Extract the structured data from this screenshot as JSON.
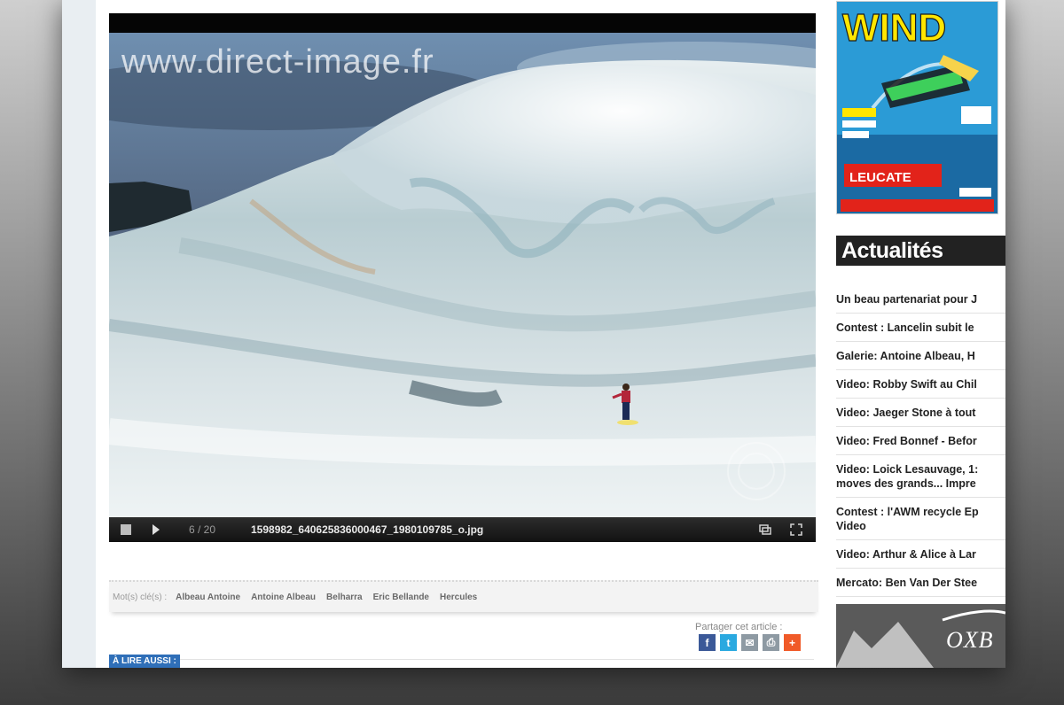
{
  "viewer": {
    "watermark": "www.direct-image.fr",
    "counter": "6 / 20",
    "filename": "1598982_640625836000467_1980109785_o.jpg",
    "icons": [
      "stop-icon",
      "play-icon",
      "window-icon",
      "fullscreen-icon"
    ]
  },
  "keywords": {
    "label": "Mot(s) clé(s) :",
    "items": [
      "Albeau Antoine",
      "Antoine Albeau",
      "Belharra",
      "Eric Bellande",
      "Hercules"
    ]
  },
  "share": {
    "label": "Partager cet article :",
    "icons": [
      {
        "name": "facebook-icon",
        "glyph": "f",
        "color": "#3b5998"
      },
      {
        "name": "twitter-icon",
        "glyph": "t",
        "color": "#2aa9e0"
      },
      {
        "name": "email-icon",
        "glyph": "✉",
        "color": "#8e9aa3"
      },
      {
        "name": "print-icon",
        "glyph": "⎙",
        "color": "#8e9aa3"
      },
      {
        "name": "plus-icon",
        "glyph": "+",
        "color": "#f05a28"
      }
    ]
  },
  "lire_aussi": "À LIRE AUSSI :",
  "magazine": {
    "title": "WIND",
    "headline": "LEUCATE",
    "colors": {
      "sky": "#2b9bd6",
      "logo": "#ffe600",
      "accent": "#e2231a"
    }
  },
  "actualites": {
    "title": "Actualités",
    "items": [
      "Un beau partenariat pour J",
      "Contest : Lancelin subit le",
      "Galerie: Antoine Albeau, H",
      "Video: Robby Swift au Chil",
      "Video: Jaeger Stone à tout",
      "Video: Fred Bonnef - Befor",
      "Video: Loick Lesauvage, 1: moves des grands... Impre",
      "Contest : l'AWM recycle Ep Video",
      "Video: Arthur & Alice à Lar",
      "Mercato: Ben Van Der Stee"
    ]
  },
  "ad": {
    "text": "OXB"
  }
}
